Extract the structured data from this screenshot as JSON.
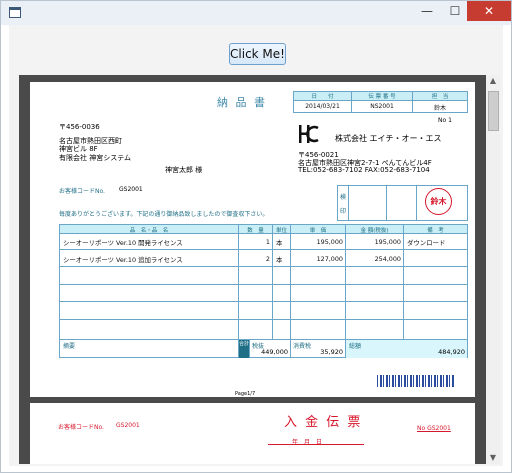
{
  "window": {
    "title": "",
    "controls": {
      "minimize": "—",
      "maximize": "☐",
      "close": "✕"
    }
  },
  "button": {
    "label": "Click Me!"
  },
  "invoice": {
    "title": "納 品 書",
    "header_cols": [
      "日　　付",
      "伝 票 番 号",
      "担　当"
    ],
    "header_vals": [
      "2014/03/21",
      "NS2001",
      "鈴木"
    ],
    "page_no": "No 1",
    "postal": "〒456-0036",
    "address1": "名古屋市熱田区西町",
    "address2": "神宮ビル 8F",
    "company": "有限会社 神宮システム",
    "person": "神宮太郎 様",
    "seller_name": "株式会社 エイチ・オー・エス",
    "seller_postal": "〒456-0021",
    "seller_address": "名古屋市熱田区神宮2-7-1 ぺんてんビル4F",
    "seller_tel": "TEL:052-683-7102 FAX:052-683-7104",
    "customer_code_label": "お客様コードNo.",
    "customer_code": "GS2001",
    "thanks": "毎度ありがとうございます。下記の通り御納品致しましたので御査収下さい。",
    "stamp_labels": [
      "検",
      "印"
    ],
    "seal_text": "鈴木",
    "table_headers": [
      "品　名・品　名",
      "数　量",
      "単位",
      "単　価",
      "金 額(税抜)",
      "備　考"
    ],
    "rows": [
      {
        "name": "シーオーリポーツ Ver.10 開発ライセンス",
        "qty": "1",
        "unit": "本",
        "price": "195,000",
        "amount": "195,000",
        "note": "ダウンロード"
      },
      {
        "name": "シーオーリポーツ Ver.10 追加ライセンス",
        "qty": "2",
        "unit": "本",
        "price": "127,000",
        "amount": "254,000",
        "note": ""
      }
    ],
    "footer": {
      "memo_label": "摘要",
      "total_label": "合計",
      "pretax_label": "税抜",
      "pretax": "449,000",
      "tax_label": "消費税",
      "tax": "35,920",
      "grand_label": "総額",
      "grand": "484,920"
    },
    "page_label": "Page1/7"
  },
  "receipt": {
    "customer_code_label": "お客様コードNo.",
    "customer_code": "GS2001",
    "title": "入 金 伝 票",
    "date_labels": "年　月　日",
    "no": "No GS2001"
  },
  "colors": {
    "accent": "#6aa6c8",
    "header_fill": "#c9eef5",
    "red": "#d6182c",
    "close": "#c73c31"
  }
}
